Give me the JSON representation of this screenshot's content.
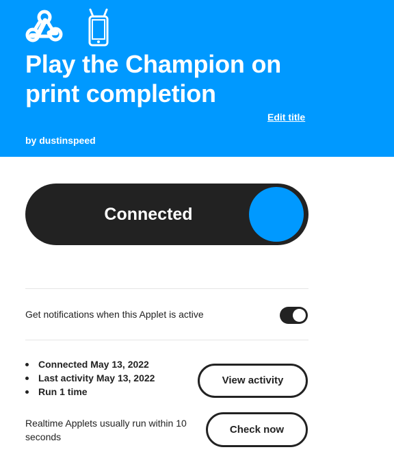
{
  "header": {
    "background_color": "#0099ff",
    "service_icons": [
      "webhooks-icon",
      "phone-icon"
    ],
    "title": "Play the Champion on print completion",
    "edit_title_label": "Edit title",
    "author": "by dustinspeed"
  },
  "connection": {
    "status_label": "Connected",
    "knob_color": "#0099ff",
    "state": "on"
  },
  "notifications": {
    "label": "Get notifications when this Applet is active",
    "enabled": true
  },
  "activity": {
    "stats": [
      "Connected May 13, 2022",
      "Last activity May 13, 2022",
      "Run 1 time"
    ],
    "view_activity_label": "View activity",
    "realtime_note": "Realtime Applets usually run within 10 seconds",
    "check_now_label": "Check now"
  }
}
